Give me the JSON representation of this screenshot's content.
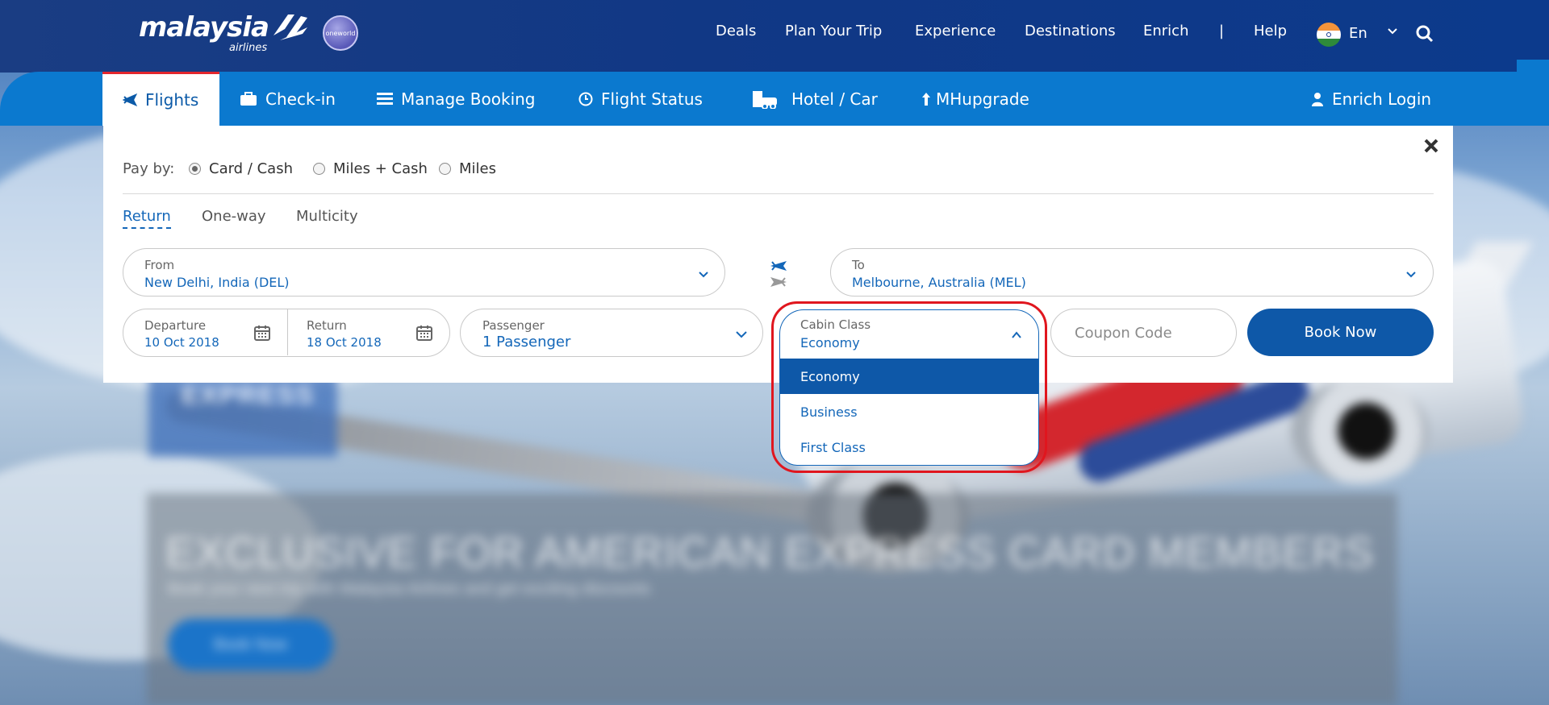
{
  "brand": {
    "logo_text": "malaysia",
    "logo_sub": "airlines",
    "alliance": "oneworld"
  },
  "topnav": {
    "items": [
      "Deals",
      "Plan Your Trip",
      "Experience",
      "Destinations",
      "Enrich",
      "|",
      "Help"
    ],
    "language": "En"
  },
  "tabs": [
    {
      "label": "Flights",
      "icon": "plane-icon",
      "active": true
    },
    {
      "label": "Check-in",
      "icon": "briefcase-icon"
    },
    {
      "label": "Manage Booking",
      "icon": "list-icon"
    },
    {
      "label": "Flight Status",
      "icon": "clock-icon"
    },
    {
      "label": "Hotel / Car",
      "icon": "hotel-car-icon"
    },
    {
      "label": "MHupgrade",
      "icon": "arrow-up-icon"
    }
  ],
  "login": {
    "label": "Enrich Login"
  },
  "booking": {
    "pay_by_label": "Pay by:",
    "pay_options": [
      "Card / Cash",
      "Miles + Cash",
      "Miles"
    ],
    "pay_selected": "Card / Cash",
    "trip_types": [
      "Return",
      "One-way",
      "Multicity"
    ],
    "trip_selected": "Return",
    "from": {
      "label": "From",
      "value": "New Delhi, India (DEL)"
    },
    "to": {
      "label": "To",
      "value": "Melbourne, Australia (MEL)"
    },
    "departure": {
      "label": "Departure",
      "value": "10 Oct 2018"
    },
    "return": {
      "label": "Return",
      "value": "18 Oct 2018"
    },
    "passenger": {
      "label": "Passenger",
      "value": "1 Passenger"
    },
    "cabin": {
      "label": "Cabin Class",
      "value": "Economy",
      "options": [
        "Economy",
        "Business",
        "First Class"
      ],
      "selected": "Economy"
    },
    "coupon_placeholder": "Coupon Code",
    "book_button": "Book Now"
  },
  "promo": {
    "badge": "EXPRESS",
    "title": "EXCLUSIVE FOR AMERICAN EXPRESS CARD MEMBERS",
    "subtitle": "Book your next trip with Malaysia Airlines and get exciting discounts",
    "button": "Book Now"
  },
  "colors": {
    "header": "#113885",
    "tabbar": "#0b79cf",
    "primary": "#0e58a8",
    "link": "#1467b9",
    "highlight": "#e0161e"
  }
}
